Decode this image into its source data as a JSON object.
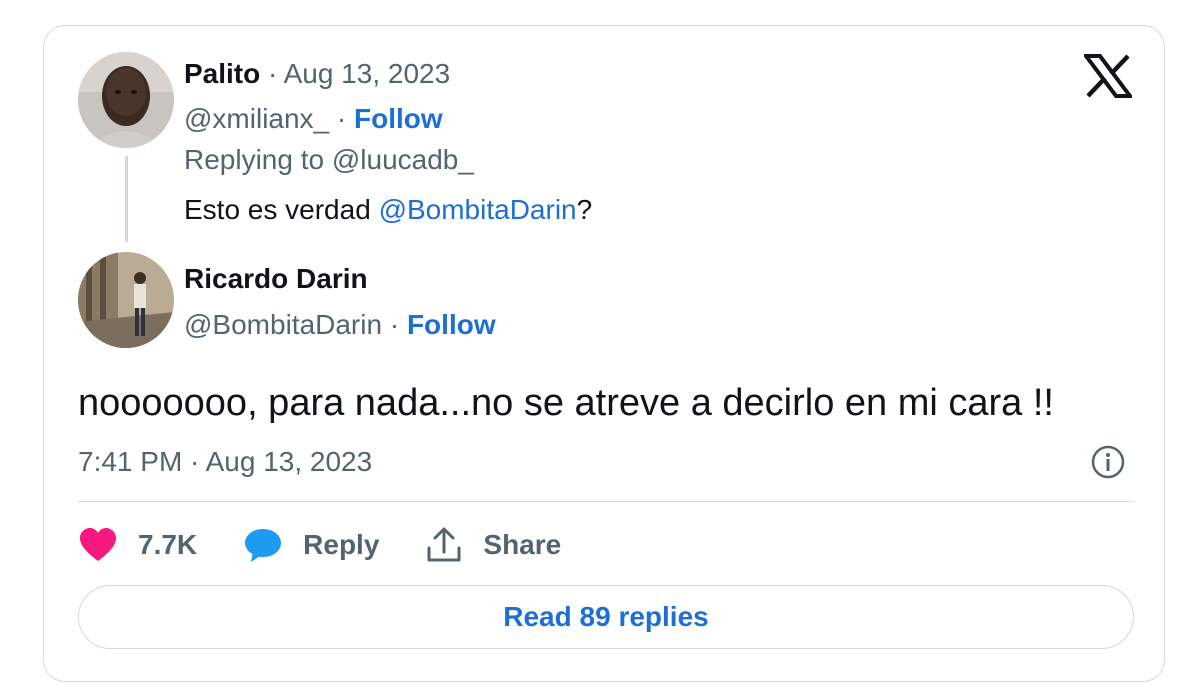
{
  "quoted": {
    "name": "Palito",
    "separator": " · ",
    "date": "Aug 13, 2023",
    "handle": "@xmilianx_",
    "handle_sep": " · ",
    "follow": "Follow",
    "replying_prefix": "Replying to ",
    "replying_handle": "@luucadb_",
    "text_before": "Esto es verdad ",
    "mention": "@BombitaDarin",
    "text_after": "?"
  },
  "author": {
    "name": "Ricardo Darin",
    "handle": "@BombitaDarin",
    "handle_sep": " · ",
    "follow": "Follow"
  },
  "tweet": {
    "text": "nooooooo, para nada...no se atreve a decirlo en mi cara !!",
    "timestamp": "7:41 PM · Aug 13, 2023"
  },
  "actions": {
    "likes": "7.7K",
    "reply": "Reply",
    "share": "Share"
  },
  "read_replies": "Read 89 replies",
  "colors": {
    "accent": "#1d6fd6",
    "like": "#f91880",
    "reply_icon": "#1d9bf0",
    "muted": "#536471",
    "border": "#cfd9de"
  },
  "icons": [
    "x-logo-icon",
    "info-icon",
    "heart-icon",
    "reply-bubble-icon",
    "share-icon"
  ]
}
